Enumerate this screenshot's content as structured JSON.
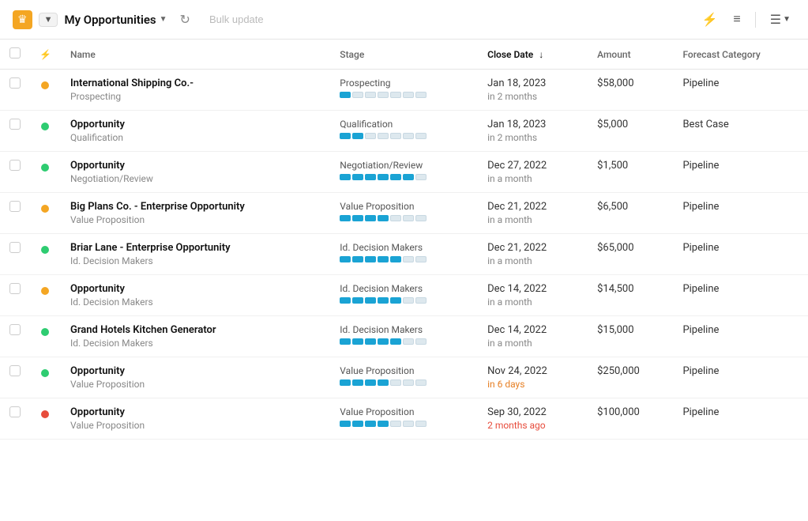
{
  "header": {
    "crown_color": "#f4a623",
    "view_title": "My Opportunities",
    "dropdown_chevron": "▼",
    "refresh_label": "↻",
    "bulk_update_label": "Bulk update",
    "icons": {
      "chart": "⚡",
      "filter": "≡",
      "list": "≡"
    }
  },
  "table": {
    "columns": [
      {
        "id": "checkbox",
        "label": ""
      },
      {
        "id": "activity",
        "label": ""
      },
      {
        "id": "name",
        "label": "Name"
      },
      {
        "id": "stage",
        "label": "Stage"
      },
      {
        "id": "close_date",
        "label": "Close Date",
        "sort": "desc",
        "sort_active": true
      },
      {
        "id": "amount",
        "label": "Amount"
      },
      {
        "id": "forecast",
        "label": "Forecast Category"
      }
    ],
    "rows": [
      {
        "dot_color": "yellow",
        "name": "International Shipping Co.-",
        "name_stage": "Prospecting",
        "stage": "Prospecting",
        "stage_segs": 1,
        "total_segs": 7,
        "close_date_main": "Jan 18, 2023",
        "close_date_sub": "in 2 months",
        "close_date_class": "normal",
        "amount": "$58,000",
        "forecast": "Pipeline"
      },
      {
        "dot_color": "green",
        "name": "Opportunity",
        "name_stage": "Qualification",
        "stage": "Qualification",
        "stage_segs": 2,
        "total_segs": 7,
        "close_date_main": "Jan 18, 2023",
        "close_date_sub": "in 2 months",
        "close_date_class": "normal",
        "amount": "$5,000",
        "forecast": "Best Case"
      },
      {
        "dot_color": "green",
        "name": "Opportunity",
        "name_stage": "Negotiation/Review",
        "stage": "Negotiation/Review",
        "stage_segs": 6,
        "total_segs": 7,
        "close_date_main": "Dec 27, 2022",
        "close_date_sub": "in a month",
        "close_date_class": "normal",
        "amount": "$1,500",
        "forecast": "Pipeline"
      },
      {
        "dot_color": "yellow",
        "name": "Big Plans Co. - Enterprise Opportunity",
        "name_stage": "Value Proposition",
        "stage": "Value Proposition",
        "stage_segs": 4,
        "total_segs": 7,
        "close_date_main": "Dec 21, 2022",
        "close_date_sub": "in a month",
        "close_date_class": "normal",
        "amount": "$6,500",
        "forecast": "Pipeline"
      },
      {
        "dot_color": "green",
        "name": "Briar Lane - Enterprise Opportunity",
        "name_stage": "Id. Decision Makers",
        "stage": "Id. Decision Makers",
        "stage_segs": 5,
        "total_segs": 7,
        "close_date_main": "Dec 21, 2022",
        "close_date_sub": "in a month",
        "close_date_class": "normal",
        "amount": "$65,000",
        "forecast": "Pipeline"
      },
      {
        "dot_color": "yellow",
        "name": "Opportunity",
        "name_stage": "Id. Decision Makers",
        "stage": "Id. Decision Makers",
        "stage_segs": 5,
        "total_segs": 7,
        "close_date_main": "Dec 14, 2022",
        "close_date_sub": "in a month",
        "close_date_class": "normal",
        "amount": "$14,500",
        "forecast": "Pipeline"
      },
      {
        "dot_color": "green",
        "name": "Grand Hotels Kitchen Generator",
        "name_stage": "Id. Decision Makers",
        "stage": "Id. Decision Makers",
        "stage_segs": 5,
        "total_segs": 7,
        "close_date_main": "Dec 14, 2022",
        "close_date_sub": "in a month",
        "close_date_class": "normal",
        "amount": "$15,000",
        "forecast": "Pipeline"
      },
      {
        "dot_color": "green",
        "name": "Opportunity",
        "name_stage": "Value Proposition",
        "stage": "Value Proposition",
        "stage_segs": 4,
        "total_segs": 7,
        "close_date_main": "Nov 24, 2022",
        "close_date_sub": "in 6 days",
        "close_date_class": "overdue",
        "amount": "$250,000",
        "forecast": "Pipeline"
      },
      {
        "dot_color": "red",
        "name": "Opportunity",
        "name_stage": "Value Proposition",
        "stage": "Value Proposition",
        "stage_segs": 4,
        "total_segs": 7,
        "close_date_main": "Sep 30, 2022",
        "close_date_sub": "2 months ago",
        "close_date_class": "urgent",
        "amount": "$100,000",
        "forecast": "Pipeline"
      }
    ]
  }
}
